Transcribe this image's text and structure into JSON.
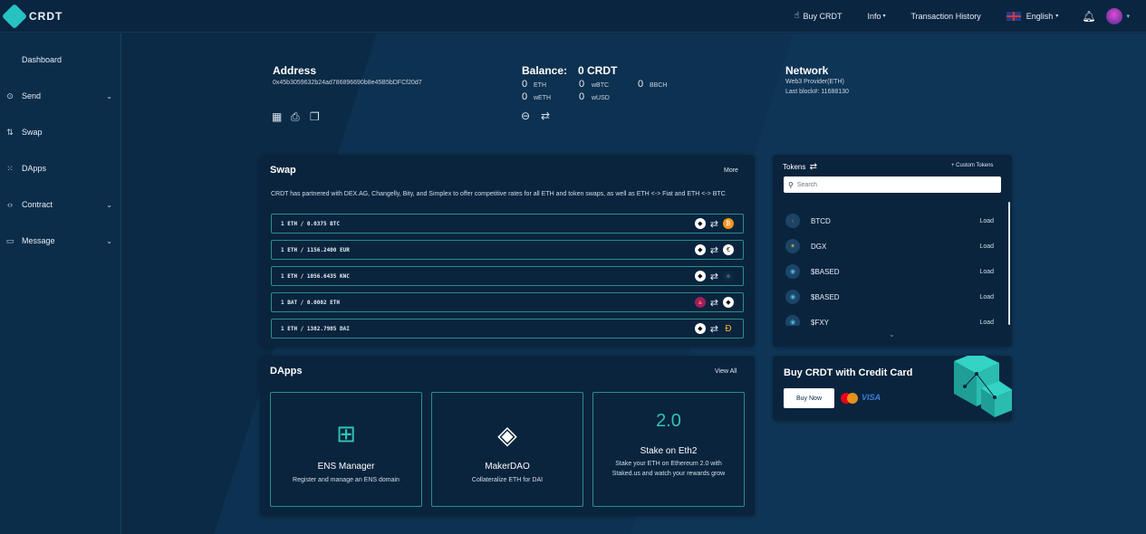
{
  "brand": {
    "name": "CRDT"
  },
  "topnav": {
    "buy": "Buy CRDT",
    "info": "Info",
    "history": "Transaction History",
    "language": "English"
  },
  "sidebar": {
    "items": [
      {
        "label": "Dashboard"
      },
      {
        "label": "Send"
      },
      {
        "label": "Swap"
      },
      {
        "label": "DApps"
      },
      {
        "label": "Contract"
      },
      {
        "label": "Message"
      }
    ]
  },
  "address": {
    "title": "Address",
    "value": "0x45b3059632b24ad786896690b8e45B5bDFCf20d7"
  },
  "balance": {
    "title": "Balance:",
    "amount": "0 CRDT",
    "tokens": [
      {
        "value": "0",
        "symbol": "ETH"
      },
      {
        "value": "0",
        "symbol": "wBTC"
      },
      {
        "value": "0",
        "symbol": "BBCH"
      },
      {
        "value": "0",
        "symbol": "wETH"
      },
      {
        "value": "0",
        "symbol": "wUSD"
      }
    ]
  },
  "network": {
    "title": "Network",
    "provider": "Web3 Provider(ETH)",
    "last_block": "Last block#: 11688130"
  },
  "swap": {
    "title": "Swap",
    "more": "More",
    "description": "CRDT has partnered with DEX.AG, Changelly, Bity, and Simplex to offer competitive rates for all ETH and token swaps, as well as ETH <-> Fiat and ETH <-> BTC",
    "rows": [
      {
        "text": "1 ETH / 0.0375 BTC",
        "to_icon": "₿",
        "to_color": "#f7931a"
      },
      {
        "text": "1 ETH / 1156.2400 EUR",
        "to_icon": "€",
        "to_color": "#ffffff"
      },
      {
        "text": "1 ETH / 1056.6435 KNC",
        "to_icon": "◆",
        "to_color": "#0f2a3f"
      },
      {
        "text": "1 BAT / 0.0002 ETH",
        "to_icon": "◆",
        "to_color": "#ffffff"
      },
      {
        "text": "1 ETH / 1382.7985 DAI",
        "to_icon": "Đ",
        "to_color": "#f4b731"
      }
    ]
  },
  "dapps": {
    "title": "DApps",
    "view_all": "View All",
    "items": [
      {
        "title": "ENS Manager",
        "desc": "Register and manage an ENS domain"
      },
      {
        "title": "MakerDAO",
        "desc": "Collateralize ETH for DAI"
      },
      {
        "title": "Stake on Eth2",
        "desc": "Stake your ETH on Ethereum 2.0 with Staked.us and watch your rewards grow",
        "badge": "2.0"
      }
    ]
  },
  "tokens": {
    "title": "Tokens",
    "custom": "+ Custom Tokens",
    "search_placeholder": "Search",
    "items": [
      {
        "name": "BTCD",
        "action": "Load"
      },
      {
        "name": "DGX",
        "action": "Load"
      },
      {
        "name": "$BASED",
        "action": "Load"
      },
      {
        "name": "$BASED",
        "action": "Load"
      },
      {
        "name": "$FXY",
        "action": "Load"
      }
    ]
  },
  "buy_card": {
    "title": "Buy CRDT with Credit Card",
    "button": "Buy Now",
    "visa": "VISA"
  }
}
